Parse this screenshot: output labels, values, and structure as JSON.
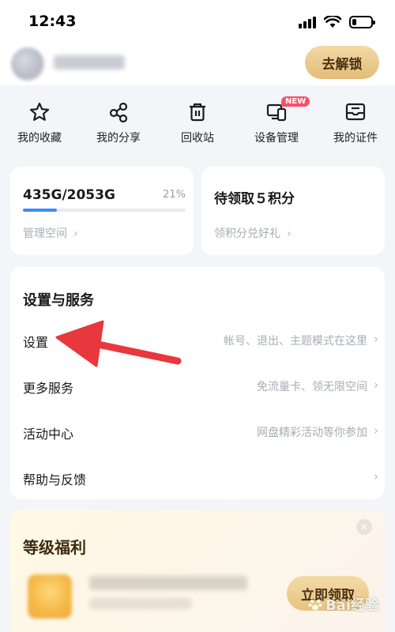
{
  "status_bar": {
    "time": "12:43"
  },
  "header": {
    "unlock_label": "去解锁"
  },
  "quick_actions": [
    {
      "label": "我的收藏",
      "icon": "star-icon"
    },
    {
      "label": "我的分享",
      "icon": "share-icon"
    },
    {
      "label": "回收站",
      "icon": "trash-icon"
    },
    {
      "label": "设备管理",
      "icon": "devices-icon",
      "badge": "NEW"
    },
    {
      "label": "我的证件",
      "icon": "id-card-icon"
    }
  ],
  "storage": {
    "amount": "435G/2053G",
    "percent": "21%",
    "used_fraction": 0.21,
    "link": "管理空间"
  },
  "points": {
    "title": "待领取５积分",
    "link": "领积分兑好礼"
  },
  "services": {
    "heading": "设置与服务",
    "rows": [
      {
        "label": "设置",
        "hint": "帐号、退出、主题模式在这里"
      },
      {
        "label": "更多服务",
        "hint": "免流量卡、领无限空间"
      },
      {
        "label": "活动中心",
        "hint": "网盘精彩活动等你参加"
      },
      {
        "label": "帮助与反馈",
        "hint": ""
      }
    ]
  },
  "benefits": {
    "title": "等级福利",
    "claim_label": "立即领取",
    "close": "×"
  },
  "watermark": {
    "text": "Bai经验"
  },
  "colors": {
    "accent": "#3d8bff",
    "arrow": "#e8383d",
    "gold": "#e3bd78",
    "badge": "#ff4d6a"
  }
}
